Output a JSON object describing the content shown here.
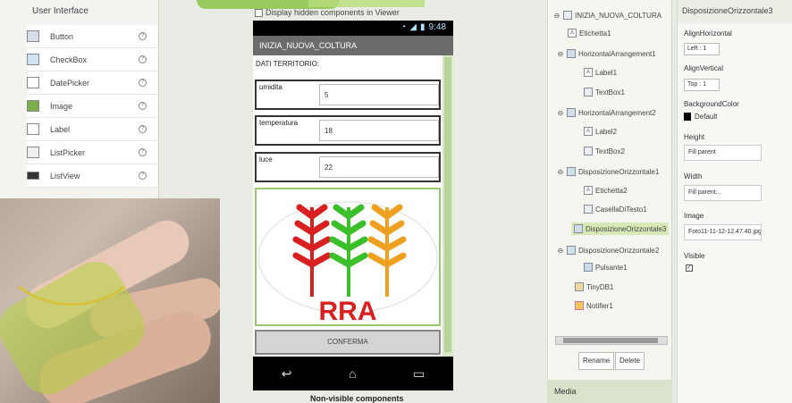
{
  "palette": {
    "title": "User Interface",
    "items": [
      {
        "label": "Button",
        "icon": "button-icon"
      },
      {
        "label": "CheckBox",
        "icon": "checkbox-icon"
      },
      {
        "label": "DatePicker",
        "icon": "datepicker-icon"
      },
      {
        "label": "Image",
        "icon": "image-icon"
      },
      {
        "label": "Label",
        "icon": "label-icon"
      },
      {
        "label": "ListPicker",
        "icon": "listpicker-icon"
      },
      {
        "label": "ListView",
        "icon": "listview-icon"
      }
    ]
  },
  "viewer": {
    "hidden_components_label": "Display hidden components in Viewer",
    "status_time": "9:48",
    "screen_title": "INIZIA_NUOVA_COLTURA",
    "dati_label": "DATI TERRITORIO:",
    "rows": [
      {
        "label": "umidita",
        "value": "5"
      },
      {
        "label": "temperatura",
        "value": "18"
      },
      {
        "label": "luce",
        "value": "22"
      }
    ],
    "logo_text": "RRA",
    "confirm_button": "CONFERMA",
    "non_visible_label": "Non-visible components"
  },
  "tree": {
    "nodes": [
      {
        "label": "INIZIA_NUOVA_COLTURA",
        "toggle": "⊖",
        "indent": 0
      },
      {
        "label": "Etichetta1",
        "toggle": "",
        "indent": 1
      },
      {
        "label": "HorizontalArrangement1",
        "toggle": "⊖",
        "indent": 1
      },
      {
        "label": "Label1",
        "toggle": "",
        "indent": 2
      },
      {
        "label": "TextBox1",
        "toggle": "",
        "indent": 2
      },
      {
        "label": "HorizontalArrangement2",
        "toggle": "⊖",
        "indent": 1
      },
      {
        "label": "Label2",
        "toggle": "",
        "indent": 2
      },
      {
        "label": "TextBox2",
        "toggle": "",
        "indent": 2
      },
      {
        "label": "DisposizioneOrizzontale1",
        "toggle": "⊖",
        "indent": 1
      },
      {
        "label": "Etichetta2",
        "toggle": "",
        "indent": 2
      },
      {
        "label": "CasellaDiTesto1",
        "toggle": "",
        "indent": 2
      },
      {
        "label": "DisposizioneOrizzontale3",
        "toggle": "",
        "indent": 1,
        "selected": true
      },
      {
        "label": "DisposizioneOrizzontale2",
        "toggle": "⊖",
        "indent": 1
      },
      {
        "label": "Pulsante1",
        "toggle": "",
        "indent": 2
      },
      {
        "label": "TinyDB1",
        "toggle": "",
        "indent": 1
      },
      {
        "label": "Notifier1",
        "toggle": "",
        "indent": 1
      }
    ],
    "rename_button": "Rename",
    "delete_button": "Delete",
    "media_label": "Media"
  },
  "properties": {
    "component_name": "DisposizioneOrizzontale3",
    "align_horizontal_label": "AlignHorizontal",
    "align_horizontal_value": "Left : 1",
    "align_vertical_label": "AlignVertical",
    "align_vertical_value": "Top : 1",
    "background_color_label": "BackgroundColor",
    "background_color_value": "Default",
    "height_label": "Height",
    "height_value": "Fill parent",
    "width_label": "Width",
    "width_value": "Fill parent...",
    "image_label": "Image",
    "image_value": "Foto11-11-12-12.47.40.jpg",
    "visible_label": "Visible",
    "visible_checked": true
  }
}
